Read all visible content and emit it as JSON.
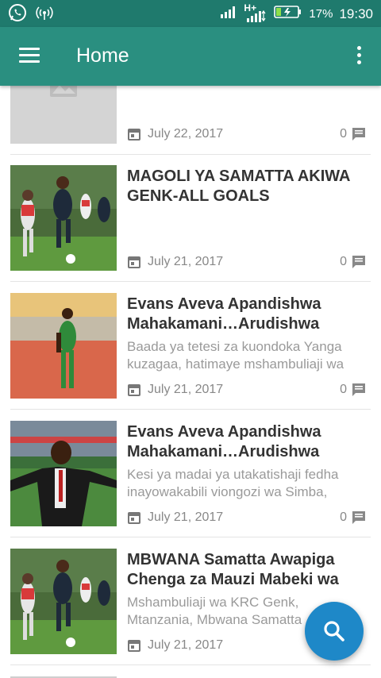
{
  "status_bar": {
    "battery": "17%",
    "time": "19:30",
    "network": "H+",
    "icons": [
      "whatsapp-icon",
      "wifi-broadcast-icon",
      "signal-icon",
      "h-plus-signal-icon",
      "battery-charging-icon"
    ]
  },
  "app_bar": {
    "title": "Home",
    "menu_icon": "hamburger-menu-icon",
    "overflow_icon": "more-vert-icon"
  },
  "articles": [
    {
      "title": "",
      "excerpt": "",
      "date": "July 22, 2017",
      "comments": "0",
      "thumbnail": "placeholder-image-icon"
    },
    {
      "title": "MAGOLI YA SAMATTA AKIWA GENK-ALL GOALS",
      "excerpt": "",
      "date": "July 21, 2017",
      "comments": "0",
      "thumbnail": "football-players-photo"
    },
    {
      "title": "Evans Aveva Apandishwa Mahakamani…Arudishwa",
      "excerpt": "Baada ya tetesi za kuondoka Yanga kuzagaa, hatimaye mshambuliaji wa",
      "date": "July 21, 2017",
      "comments": "0",
      "thumbnail": "footballer-stadium-photo"
    },
    {
      "title": "Evans Aveva Apandishwa Mahakamani…Arudishwa",
      "excerpt": "Kesi ya madai ya utakatishaji fedha inayowakabili viongozi wa Simba,",
      "date": "July 21, 2017",
      "comments": "0",
      "thumbnail": "man-in-suit-photo"
    },
    {
      "title": "MBWANA Samatta Awapiga Chenga za Mauzi Mabeki wa",
      "excerpt": "Mshambuliaji wa KRC Genk, Mtanzania, Mbwana Samatta",
      "date": "July 21, 2017",
      "comments": "",
      "thumbnail": "football-players-photo"
    }
  ],
  "fab": {
    "icon": "search-icon"
  },
  "colors": {
    "status_bar": "#1f7a6d",
    "app_bar": "#2a8f80",
    "fab": "#1e88c8",
    "title_text": "#333333",
    "meta_text": "#888888"
  }
}
